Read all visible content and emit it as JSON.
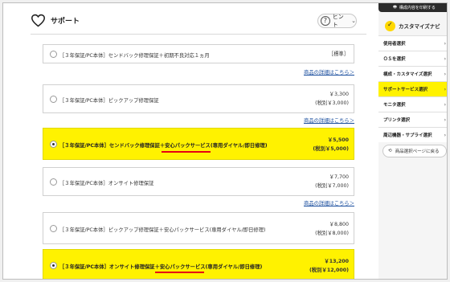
{
  "header": {
    "title": "サポート",
    "hint_label": "ヒント",
    "hint_symbol": "?"
  },
  "options": [
    {
      "label": "［３年保証/PC本体］センドバック修理保証＋初期不良対応１ヵ月",
      "price": "［標準］",
      "tax": "",
      "selected": false,
      "link": "商品の詳細はこちら＞"
    },
    {
      "label": "［３年保証/PC本体］ピックアップ修理保証",
      "price": "￥3,300",
      "tax": "(税別￥3,000)",
      "selected": false,
      "link": "商品の詳細はこちら＞"
    },
    {
      "label": "［３年保証/PC本体］センドバック修理保証＋安心パックサービス(専用ダイヤル/即日修理)",
      "price": "￥5,500",
      "tax": "(税別￥5,000)",
      "selected": true,
      "link": ""
    },
    {
      "label": "［３年保証/PC本体］オンサイト修理保証",
      "price": "￥7,700",
      "tax": "(税別￥7,000)",
      "selected": false,
      "link": "商品の詳細はこちら＞"
    },
    {
      "label": "［３年保証/PC本体］ピックアップ修理保証＋安心パックサービス(専用ダイヤル/即日修理)",
      "price": "￥8,800",
      "tax": "(税別￥8,000)",
      "selected": false,
      "link": ""
    },
    {
      "label": "［３年保証/PC本体］オンサイト修理保証＋安心パックサービス(専用ダイヤル/即日修理)",
      "price": "￥13,200",
      "tax": "(税別￥12,000)",
      "selected": true,
      "link": ""
    }
  ],
  "sidebar": {
    "print_label": "構成内容を印刷する",
    "navi_title": "カスタマイズナビ",
    "items": [
      {
        "label": "使用者選択",
        "active": false
      },
      {
        "label": "ＯＳを選択",
        "active": false
      },
      {
        "label": "構成・カスタマイズ選択",
        "active": false
      },
      {
        "label": "サポートサービス選択",
        "active": true
      },
      {
        "label": "モニタ選択",
        "active": false
      },
      {
        "label": "プリンタ選択",
        "active": false
      },
      {
        "label": "周辺機器・サプライ選択",
        "active": false
      }
    ],
    "back_label": "商品選択ページに戻る"
  },
  "colors": {
    "highlight": "#fff200",
    "underline": "#e60012",
    "link": "#1a4e9e"
  }
}
